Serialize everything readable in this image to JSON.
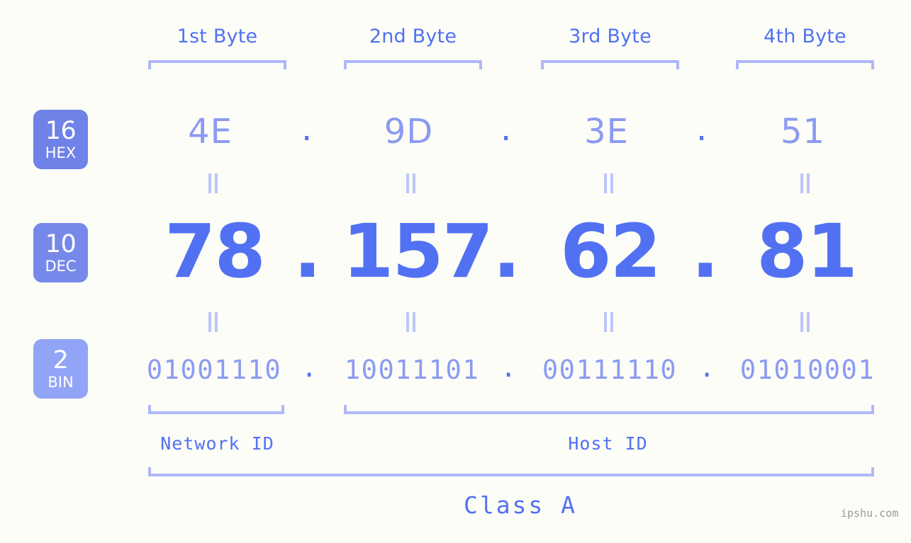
{
  "background_color": "#fcfdf7",
  "accent_color": "#5271f2",
  "muted_accent_color": "#8b9bf2",
  "bracket_color": "#aeb8f7",
  "byte_headers": [
    {
      "label": "1st Byte"
    },
    {
      "label": "2nd Byte"
    },
    {
      "label": "3rd Byte"
    },
    {
      "label": "4th Byte"
    }
  ],
  "bases": [
    {
      "number": "16",
      "name": "HEX",
      "color": "#6f82e8"
    },
    {
      "number": "10",
      "name": "DEC",
      "color": "#7689ea"
    },
    {
      "number": "2",
      "name": "BIN",
      "color": "#92a4f6"
    }
  ],
  "separator": ".",
  "hex": {
    "values": [
      "4E",
      "9D",
      "3E",
      "51"
    ]
  },
  "dec": {
    "values": [
      "78",
      "157",
      "62",
      "81"
    ]
  },
  "bin": {
    "values": [
      "01001110",
      "10011101",
      "00111110",
      "01010001"
    ]
  },
  "equals_glyph": "=",
  "segments": {
    "network_id_label": "Network ID",
    "host_id_label": "Host ID",
    "class_label": "Class A"
  },
  "watermark": "ipshu.com"
}
